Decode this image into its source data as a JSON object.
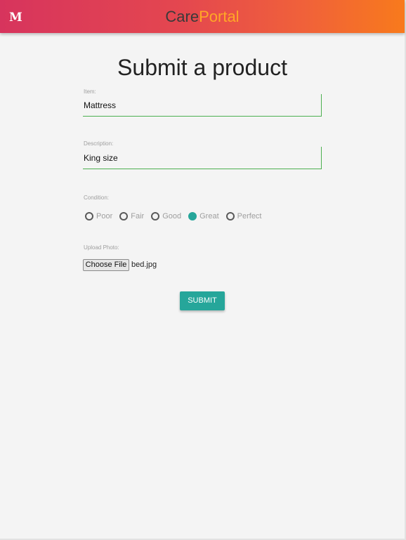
{
  "header": {
    "logo": "M",
    "brand_part1": "Care",
    "brand_part2": "Portal"
  },
  "page": {
    "title": "Submit a product"
  },
  "form": {
    "item": {
      "label": "Item:",
      "value": "Mattress"
    },
    "description": {
      "label": "Description:",
      "value": "King size"
    },
    "condition": {
      "label": "Condition:",
      "options": [
        "Poor",
        "Fair",
        "Good",
        "Great",
        "Perfect"
      ],
      "selected": "Great"
    },
    "photo": {
      "label": "Upload Photo:",
      "button_label": "Choose File",
      "file_name": "bed.jpg"
    },
    "submit_label": "SUBMIT"
  },
  "colors": {
    "header_gradient_start": "#d7345d",
    "header_gradient_end": "#f87a1c",
    "brand_accent": "#ffa726",
    "primary": "#26a69a",
    "field_underline": "#4caf50"
  }
}
